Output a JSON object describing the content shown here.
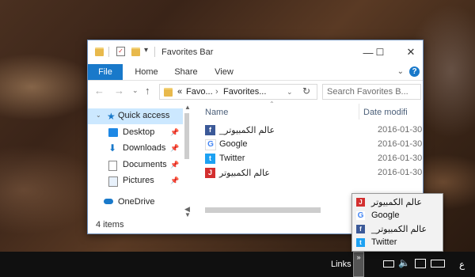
{
  "window": {
    "title": "Favorites Bar",
    "controls": {
      "minimize": "—",
      "maximize": "☐",
      "close": "✕"
    }
  },
  "ribbon": {
    "tabs": [
      "File",
      "Home",
      "Share",
      "View"
    ],
    "help": "?"
  },
  "address": {
    "crumbs_prefix": "«",
    "crumb1": "Favo...",
    "separator": "›",
    "crumb2": "Favorites...",
    "search_placeholder": "Search Favorites B..."
  },
  "nav": {
    "items": [
      {
        "label": "Quick access",
        "icon": "star-icon",
        "pinned": false
      },
      {
        "label": "Desktop",
        "icon": "desktop-icon",
        "pinned": true
      },
      {
        "label": "Downloads",
        "icon": "download-icon",
        "pinned": true
      },
      {
        "label": "Documents",
        "icon": "document-icon",
        "pinned": true
      },
      {
        "label": "Pictures",
        "icon": "picture-icon",
        "pinned": true
      },
      {
        "label": "OneDrive",
        "icon": "cloud-icon",
        "pinned": false
      }
    ]
  },
  "columns": {
    "name": "Name",
    "date": "Date modifi"
  },
  "files": [
    {
      "name": "_عالم الكمبيوتر",
      "date": "2016-01-30",
      "icon": "facebook-icon"
    },
    {
      "name": "Google",
      "date": "2016-01-30",
      "icon": "google-icon"
    },
    {
      "name": "Twitter",
      "date": "2016-01-30",
      "icon": "twitter-icon"
    },
    {
      "name": "عالم الكمبيوتر",
      "date": "2016-01-30",
      "icon": "site-icon"
    }
  ],
  "status": "4 items",
  "taskbar": {
    "links_label": "Links",
    "chevron": "»",
    "lang": "ع"
  },
  "links_popup": [
    {
      "name": "عالم الكمبيوتر",
      "icon": "site-icon"
    },
    {
      "name": "Google",
      "icon": "google-icon"
    },
    {
      "name": "_عالم الكمبيوتر",
      "icon": "facebook-icon"
    },
    {
      "name": "Twitter",
      "icon": "twitter-icon"
    }
  ],
  "colors": {
    "accent": "#1979ca",
    "selection": "#cce8ff",
    "facebook": "#3b5998",
    "twitter": "#1da1f2",
    "site": "#d32f2f"
  }
}
